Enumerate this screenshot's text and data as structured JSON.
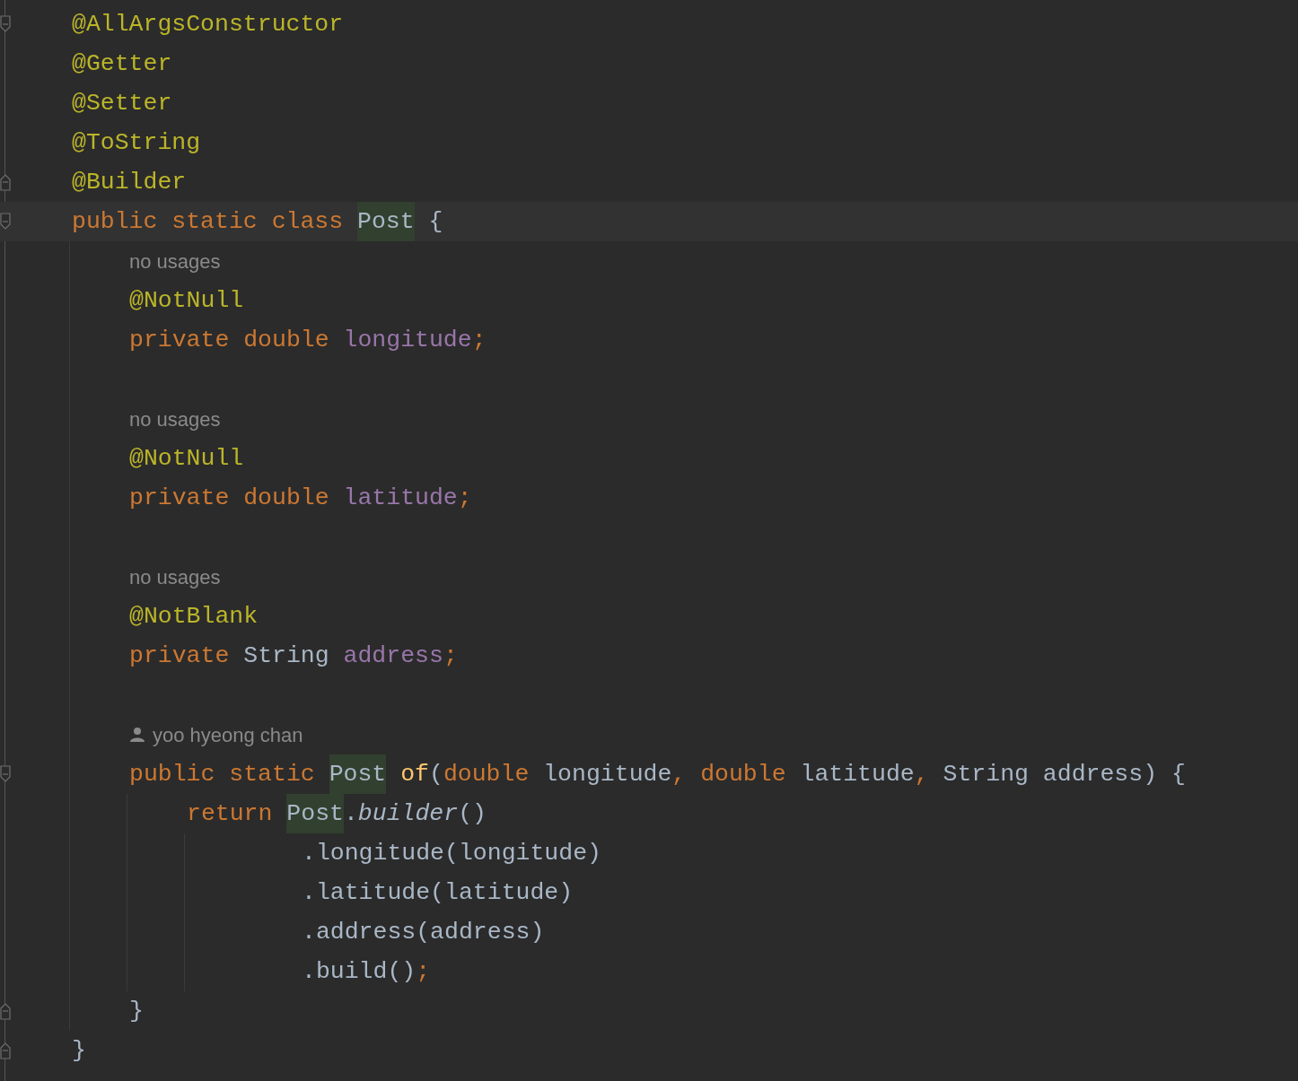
{
  "editor": {
    "lines": [
      {
        "kind": "code",
        "fold": {
          "kind": "start"
        },
        "tokens": [
          {
            "text": "@AllArgsConstructor",
            "kind": "annotation"
          }
        ]
      },
      {
        "kind": "code",
        "tokens": [
          {
            "text": "@Getter",
            "kind": "annotation"
          }
        ]
      },
      {
        "kind": "code",
        "tokens": [
          {
            "text": "@Setter",
            "kind": "annotation"
          }
        ]
      },
      {
        "kind": "code",
        "tokens": [
          {
            "text": "@ToString",
            "kind": "annotation"
          }
        ]
      },
      {
        "kind": "code",
        "fold": {
          "kind": "end"
        },
        "tokens": [
          {
            "text": "@Builder",
            "kind": "annotation"
          }
        ]
      },
      {
        "kind": "code",
        "fold": {
          "kind": "start"
        },
        "current": true,
        "tokens": [
          {
            "text": "public static class ",
            "kind": "keyword"
          },
          {
            "text": "Post",
            "kind": "plain",
            "highlighted": true
          },
          {
            "text": " {",
            "kind": "plain"
          }
        ],
        "children": [
          {
            "kind": "hint",
            "text": "no usages"
          },
          {
            "kind": "code",
            "tokens": [
              {
                "text": "@NotNull",
                "kind": "annotation"
              }
            ]
          },
          {
            "kind": "code",
            "tokens": [
              {
                "text": "private double ",
                "kind": "keyword"
              },
              {
                "text": "longitude",
                "kind": "field"
              },
              {
                "text": ";",
                "kind": "punct"
              }
            ]
          },
          {
            "kind": "blank"
          },
          {
            "kind": "hint",
            "text": "no usages"
          },
          {
            "kind": "code",
            "tokens": [
              {
                "text": "@NotNull",
                "kind": "annotation"
              }
            ]
          },
          {
            "kind": "code",
            "tokens": [
              {
                "text": "private double ",
                "kind": "keyword"
              },
              {
                "text": "latitude",
                "kind": "field"
              },
              {
                "text": ";",
                "kind": "punct"
              }
            ]
          },
          {
            "kind": "blank"
          },
          {
            "kind": "hint",
            "text": "no usages"
          },
          {
            "kind": "code",
            "tokens": [
              {
                "text": "@NotBlank",
                "kind": "annotation"
              }
            ]
          },
          {
            "kind": "code",
            "tokens": [
              {
                "text": "private ",
                "kind": "keyword"
              },
              {
                "text": "String ",
                "kind": "plain"
              },
              {
                "text": "address",
                "kind": "field"
              },
              {
                "text": ";",
                "kind": "punct"
              }
            ]
          },
          {
            "kind": "blank"
          },
          {
            "kind": "author",
            "text": "yoo hyeong chan"
          },
          {
            "kind": "code",
            "fold": {
              "kind": "start"
            },
            "tokens": [
              {
                "text": "public static ",
                "kind": "keyword"
              },
              {
                "text": "Post",
                "kind": "plain",
                "highlighted": true
              },
              {
                "text": " of",
                "kind": "method_decl"
              },
              {
                "text": "(",
                "kind": "plain"
              },
              {
                "text": "double ",
                "kind": "keyword"
              },
              {
                "text": "longitude",
                "kind": "plain"
              },
              {
                "text": ", ",
                "kind": "punct"
              },
              {
                "text": "double ",
                "kind": "keyword"
              },
              {
                "text": "latitude",
                "kind": "plain"
              },
              {
                "text": ", ",
                "kind": "punct"
              },
              {
                "text": "String address) {",
                "kind": "plain"
              }
            ],
            "children": [
              {
                "kind": "code",
                "tokens": [
                  {
                    "text": "return ",
                    "kind": "keyword"
                  },
                  {
                    "text": "Post",
                    "kind": "plain",
                    "highlighted": true
                  },
                  {
                    "text": ".",
                    "kind": "plain"
                  },
                  {
                    "text": "builder",
                    "kind": "static_call"
                  },
                  {
                    "text": "()",
                    "kind": "plain"
                  }
                ],
                "continuation": [
                  {
                    "kind": "code",
                    "tokens": [
                      {
                        "text": ".longitude(longitude)",
                        "kind": "plain"
                      }
                    ]
                  },
                  {
                    "kind": "code",
                    "tokens": [
                      {
                        "text": ".latitude(latitude)",
                        "kind": "plain"
                      }
                    ]
                  },
                  {
                    "kind": "code",
                    "tokens": [
                      {
                        "text": ".address(address)",
                        "kind": "plain"
                      }
                    ]
                  },
                  {
                    "kind": "code",
                    "tokens": [
                      {
                        "text": ".build()",
                        "kind": "plain"
                      },
                      {
                        "text": ";",
                        "kind": "punct"
                      }
                    ]
                  }
                ]
              }
            ]
          },
          {
            "kind": "code",
            "fold": {
              "kind": "end"
            },
            "tokens": [
              {
                "text": "}",
                "kind": "plain"
              }
            ]
          }
        ]
      },
      {
        "kind": "code",
        "fold": {
          "kind": "end"
        },
        "tokens": [
          {
            "text": "}",
            "kind": "plain"
          }
        ]
      }
    ]
  }
}
